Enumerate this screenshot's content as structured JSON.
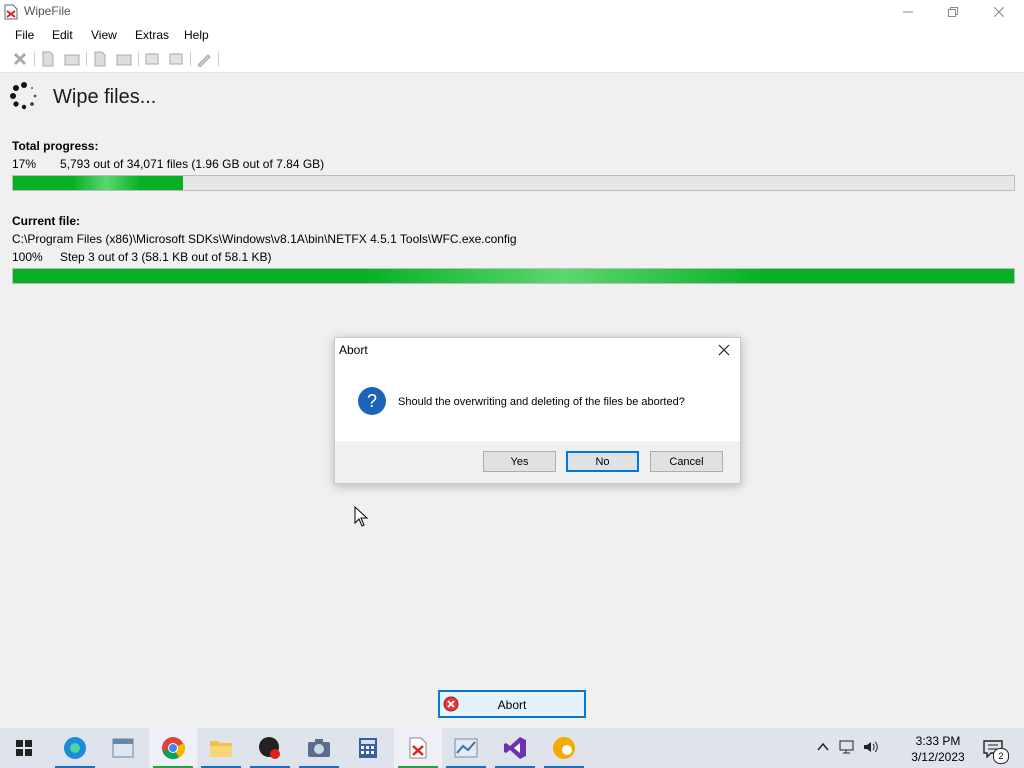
{
  "window": {
    "title": "WipeFile"
  },
  "menu": [
    "File",
    "Edit",
    "View",
    "Extras",
    "Help"
  ],
  "heading": "Wipe files...",
  "total": {
    "label": "Total progress:",
    "percent": "17%",
    "details": "5,793 out of 34,071 files (1.96 GB out of 7.84 GB)",
    "progress": 0.17
  },
  "current": {
    "label": "Current file:",
    "path": "C:\\Program Files (x86)\\Microsoft SDKs\\Windows\\v8.1A\\bin\\NETFX 4.5.1 Tools\\WFC.exe.config",
    "percent": "100%",
    "details": "Step 3 out of 3 (58.1 KB out of 58.1 KB)",
    "progress": 1.0
  },
  "dialog": {
    "title": "Abort",
    "message": "Should the overwriting and deleting of the files be aborted?",
    "buttons": {
      "yes": "Yes",
      "no": "No",
      "cancel": "Cancel"
    }
  },
  "abort_button": "Abort",
  "taskbar": {
    "apps": [
      "start-icon",
      "edge-icon",
      "window-app-icon",
      "chrome-icon",
      "file-explorer-icon",
      "media-app-icon",
      "camera-icon",
      "calculator-icon",
      "wipefile-icon",
      "charts-app-icon",
      "visual-studio-icon",
      "canary-browser-icon"
    ],
    "time": "3:33 PM",
    "date": "3/12/2023",
    "notification_count": "2"
  },
  "colors": {
    "progress_green": "#06b025",
    "accent": "#0078d7"
  }
}
